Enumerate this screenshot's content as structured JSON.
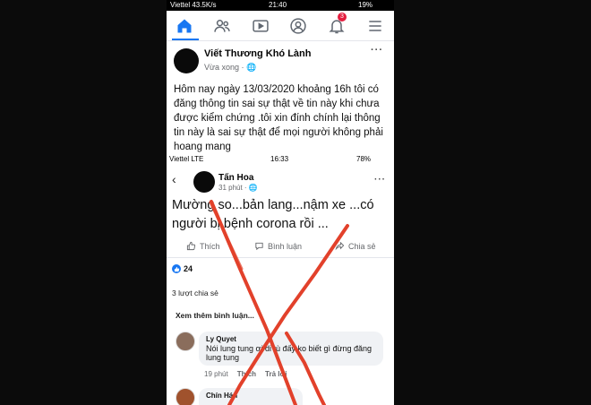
{
  "status_bar": {
    "carrier": "Viettel 43.5K/s",
    "time": "21:40",
    "battery": "19%"
  },
  "nav": {
    "icons": [
      "home-icon",
      "friends-icon",
      "watch-icon",
      "profile-icon",
      "bell-icon",
      "menu-icon"
    ],
    "notification_count": "3"
  },
  "post": {
    "author": "Viết Thương Khó Lành",
    "meta": "Vừa xong · ",
    "more": "···",
    "text": "Hôm nay ngày 13/03/2020 khoảng 16h tôi có đăng  thông tin sai sự thật về tin này khi chưa được kiểm chứng .tôi xin đính chính lại thông tin này là sai sự thật để mọi người không phải hoang mang"
  },
  "screenshot": {
    "status_bar": {
      "carrier": "Viettel  LTE",
      "time": "16:33",
      "battery": "78%"
    },
    "author": "Tấn Hoa",
    "meta": "31 phút · ",
    "more": "···",
    "text": "Mường so...bản lang...nậm xe ...có người bị bệnh corona rồi ...",
    "actions": {
      "like": "Thích",
      "comment": "Bình luận",
      "share": "Chia sẻ"
    },
    "reaction_count": "24",
    "shares": "3 lượt chia sẻ",
    "view_more": "Xem thêm bình luận...",
    "comments": [
      {
        "name": "Ly Quyet",
        "text": "Nói lung tung ơi di tù đấy ko biết gì đừng đăng lung tung",
        "time": "19 phút",
        "like": "Thích",
        "reply": "Trả lời"
      },
      {
        "name": "Chín Hán",
        "text": ""
      }
    ]
  },
  "colors": {
    "facebook_blue": "#1877f2",
    "cross_red": "#e2412b",
    "badge_red": "#e41e3f"
  }
}
